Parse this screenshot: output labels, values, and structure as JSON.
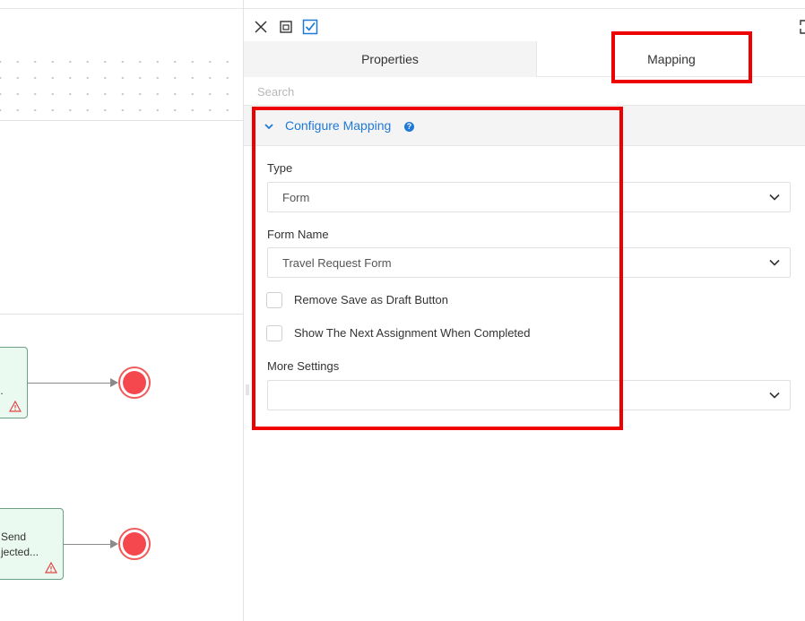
{
  "canvas": {
    "task1": {
      "text": ".."
    },
    "task2": {
      "line1": "Send",
      "line2": "jected..."
    }
  },
  "panel": {
    "toolbar": {
      "close_icon": "close-icon",
      "window_icon": "window-icon",
      "check_icon": "checkbox-checked-icon",
      "expand_icon": "expand-icon"
    },
    "tabs": [
      {
        "label": "Properties"
      },
      {
        "label": "Mapping"
      }
    ],
    "search": {
      "placeholder": "Search"
    },
    "section": {
      "title": "Configure Mapping",
      "help": "?"
    },
    "fields": {
      "type": {
        "label": "Type",
        "value": "Form"
      },
      "form_name": {
        "label": "Form Name",
        "value": "Travel Request Form"
      },
      "remove_draft": {
        "label": "Remove Save as Draft Button",
        "checked": false
      },
      "show_next": {
        "label": "Show The Next Assignment When Completed",
        "checked": false
      },
      "more_settings": {
        "label": "More Settings",
        "value": ""
      }
    }
  },
  "colors": {
    "accent": "#1f79d8",
    "highlight": "#ee0000",
    "end_event": "#f5474e",
    "task_fill": "#eafaf1"
  }
}
